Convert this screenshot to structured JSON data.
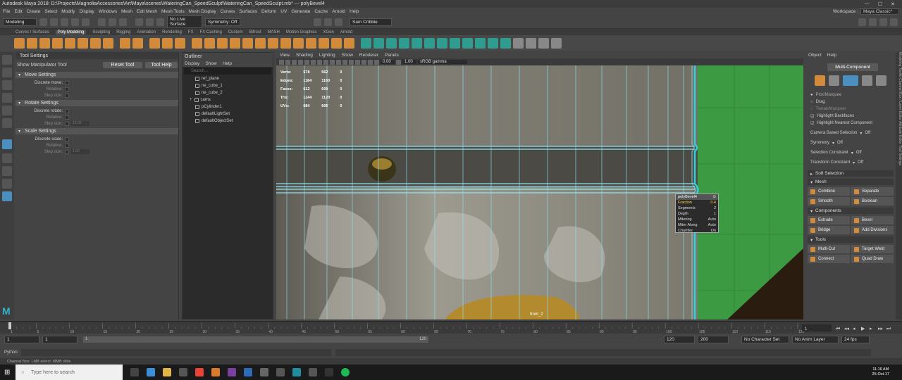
{
  "title_bar": {
    "text": "Autodesk Maya 2018: D:\\Projects\\MagnoliaAccessories\\Art\\Maya\\scenes\\WateringCan_SpeedSculpt\\WateringCan_SpeedSculpt.mb*   ---   polyBevel4"
  },
  "menu": {
    "items": [
      "File",
      "Edit",
      "Create",
      "Select",
      "Modify",
      "Display",
      "Windows",
      "Mesh",
      "Edit Mesh",
      "Mesh Tools",
      "Mesh Display",
      "Curves",
      "Surfaces",
      "Deform",
      "UV",
      "Generate",
      "Cache",
      "Arnold",
      "Help"
    ],
    "workspace_label": "Workspace :",
    "workspace_value": "Maya Classic*"
  },
  "status": {
    "mode": "Modeling",
    "live": "No Live Surface",
    "symmetry": "Symmetry: Off",
    "user": "Sam Cribbie"
  },
  "shelf_tabs": [
    "Curves / Surfaces",
    "Poly Modeling",
    "Sculpting",
    "Rigging",
    "Animation",
    "Rendering",
    "FX",
    "FX Caching",
    "Custom",
    "Bifrost",
    "MASH",
    "Motion Graphics",
    "XGen",
    "Arnold"
  ],
  "shelf_active": "Poly Modeling",
  "tool_settings": {
    "panel_title": "Tool Settings",
    "tool_name": "Show Manipulator Tool",
    "reset_label": "Reset Tool",
    "help_label": "Tool Help",
    "move": {
      "title": "Move Settings",
      "discrete": "Discrete move:",
      "relative": "Relative:",
      "step": "Step size:"
    },
    "rotate": {
      "title": "Rotate Settings",
      "discrete": "Discrete rotate:",
      "relative": "Relative:",
      "step": "Step size:",
      "step_val": "15.00"
    },
    "scale": {
      "title": "Scale Settings",
      "discrete": "Discrete scale:",
      "relative": "Relative:",
      "step": "Step size:",
      "step_val": "1.00"
    }
  },
  "outliner": {
    "title": "Outliner",
    "menu": [
      "Display",
      "Show",
      "Help"
    ],
    "search_placeholder": "Search...",
    "items": [
      "ref_plane",
      "ne_cube_1",
      "ne_cube_2",
      "cams",
      "pCylinder1",
      "defaultLightSet",
      "defaultObjectSet"
    ]
  },
  "viewport": {
    "menu": [
      "View",
      "Shading",
      "Lighting",
      "Show",
      "Renderer",
      "Panels"
    ],
    "val1": "0.00",
    "val2": "1.00",
    "colorspace": "sRGB gamma",
    "hud": [
      {
        "label": "Verts:",
        "a": "578",
        "b": "562",
        "c": "0"
      },
      {
        "label": "Edges:",
        "a": "1184",
        "b": "1160",
        "c": "0"
      },
      {
        "label": "Faces:",
        "a": "612",
        "b": "600",
        "c": "0"
      },
      {
        "label": "Tris:",
        "a": "1144",
        "b": "1120",
        "c": "0"
      },
      {
        "label": "UVs:",
        "a": "684",
        "b": "606",
        "c": "0"
      }
    ],
    "camera_label": "front_2"
  },
  "bevel_popup": {
    "title": "polyBevel4",
    "rows": [
      {
        "k": "Fraction",
        "v": "0.4"
      },
      {
        "k": "Segments",
        "v": "2"
      },
      {
        "k": "Depth",
        "v": "1"
      },
      {
        "k": "Mitering",
        "v": "Auto"
      },
      {
        "k": "Miter Along",
        "v": "Auto"
      },
      {
        "k": "Chamfer",
        "v": "On"
      }
    ]
  },
  "modeling_toolkit": {
    "menu": [
      "Object",
      "Help"
    ],
    "mode": "Multi-Component",
    "pick": "Pick/Marquee",
    "drag": "Drag",
    "tweak": "Tweak/Marquee",
    "backfaces": "Highlight Backfaces",
    "nearest": "Highlight Nearest Component",
    "camera_sel": "Camera Based Selection",
    "camera_val": "Off",
    "symmetry": "Symmetry",
    "symmetry_val": "Off",
    "sel_constraint": "Selection Constraint",
    "sel_val": "Off",
    "xf_constraint": "Transform Constraint",
    "xf_val": "Off",
    "soft": "Soft Selection",
    "mesh_title": "Mesh",
    "mesh": [
      "Combine",
      "Separate",
      "Smooth",
      "Boolean"
    ],
    "comp_title": "Components",
    "comp": [
      "Extrude",
      "Bevel",
      "Bridge",
      "Add Divisions"
    ],
    "tools_title": "Tools",
    "tools": [
      "Multi-Cut",
      "Target Weld",
      "Connect",
      "Quad Draw"
    ]
  },
  "side_tabs": "Modeling Toolkit   Channel Box / Layer Editor   Attribute Editor   Tool Settings",
  "timeline": {
    "ticks": [
      "1",
      "5",
      "10",
      "15",
      "20",
      "25",
      "30",
      "35",
      "40",
      "45",
      "50",
      "55",
      "60",
      "65",
      "70",
      "75",
      "80",
      "85",
      "90",
      "95",
      "100",
      "105",
      "110",
      "115",
      "120"
    ],
    "current": "1"
  },
  "range": {
    "start": "1",
    "start2": "1",
    "slider_start": "1",
    "slider_end": "120",
    "end": "120",
    "end2": "200",
    "charset": "No Character Set",
    "anim_layer": "No Anim Layer",
    "fps": "24 fps"
  },
  "command": {
    "lang": "Python"
  },
  "help_line": "Channel Box: LMB select. MMB slide",
  "taskbar": {
    "search": "Type here to search",
    "time": "11:16 AM",
    "date": "25-Oct-17"
  },
  "colors": {
    "accent": "#4a8fc0",
    "green_plane": "#3c9a43",
    "orange_icon": "#d28b3a"
  }
}
